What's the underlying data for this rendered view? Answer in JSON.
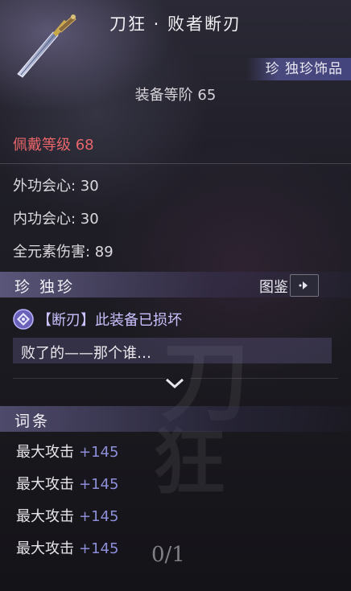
{
  "item": {
    "title": "刀狂 · 败者断刃",
    "rarity_tag": "珍 独珍饰品",
    "equip_rank": "装备等阶 65",
    "wear_level": "佩戴等级 68"
  },
  "stats": [
    {
      "label": "外功会心: 30"
    },
    {
      "label": "内功会心: 30"
    },
    {
      "label": "全元素伤害: 89"
    }
  ],
  "quality_section": {
    "title": "珍 独珍",
    "codex_label": "图鉴",
    "codex_icon": "chevron-right-icon"
  },
  "broken_status": {
    "icon": "broken-gem-icon",
    "text": "【断刃】此装备已损坏"
  },
  "flavor_text": "败了的——那个谁…",
  "affix_section": {
    "title": "词条",
    "items": [
      {
        "name": "最大攻击",
        "value": "+145"
      },
      {
        "name": "最大攻击",
        "value": "+145"
      },
      {
        "name": "最大攻击",
        "value": "+145"
      },
      {
        "name": "最大攻击",
        "value": "+145"
      }
    ],
    "page_count": "0/1"
  },
  "colors": {
    "wear_level": "#e9666a",
    "affix_value": "#8e8ed8",
    "broken_text": "#c9c2ff"
  }
}
